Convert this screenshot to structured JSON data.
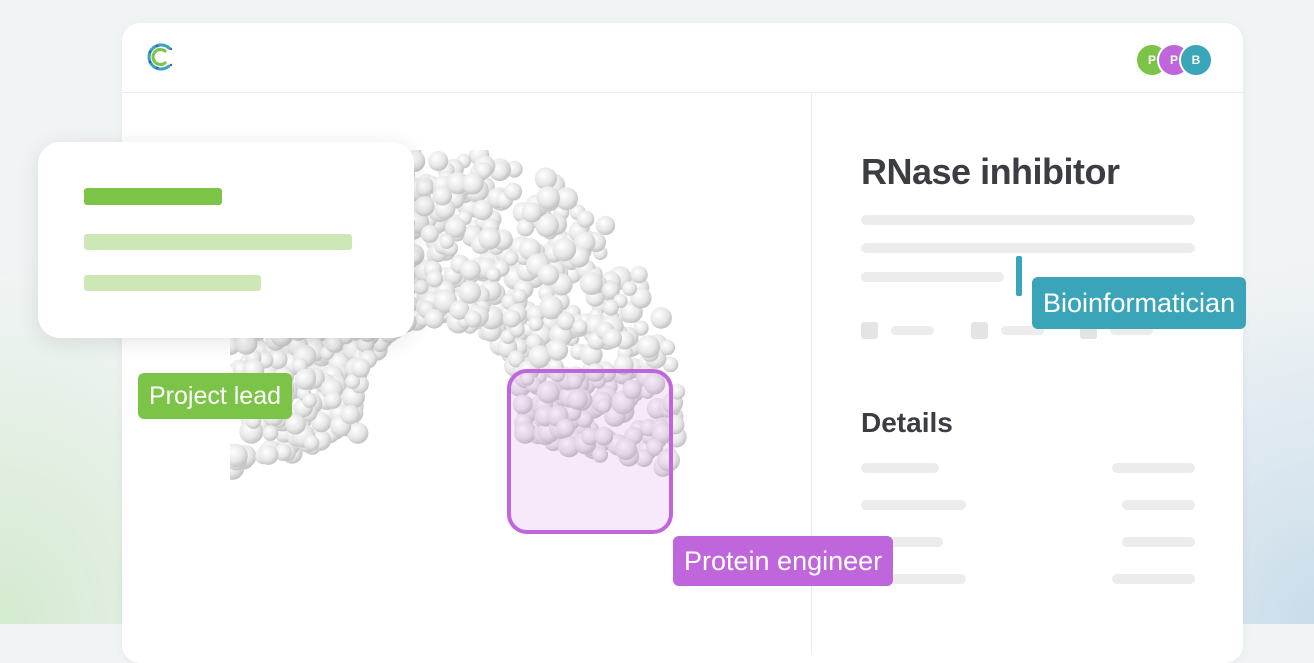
{
  "panel": {
    "title": "RNase inhibitor",
    "details_heading": "Details"
  },
  "collaborators": [
    {
      "initial": "P",
      "color": "#7cc447"
    },
    {
      "initial": "P",
      "color": "#c066dc"
    },
    {
      "initial": "B",
      "color": "#3aa5b8"
    }
  ],
  "roles": {
    "project_lead": "Project lead",
    "protein_engineer": "Protein engineer",
    "bioinformatician": "Bioinformatician"
  },
  "colors": {
    "green": "#7cc447",
    "purple": "#c066dc",
    "teal": "#3aa5b8",
    "heading": "#3b3d42"
  },
  "icons": {
    "logo": "app-logo-icon",
    "molecule": "protein-structure"
  }
}
